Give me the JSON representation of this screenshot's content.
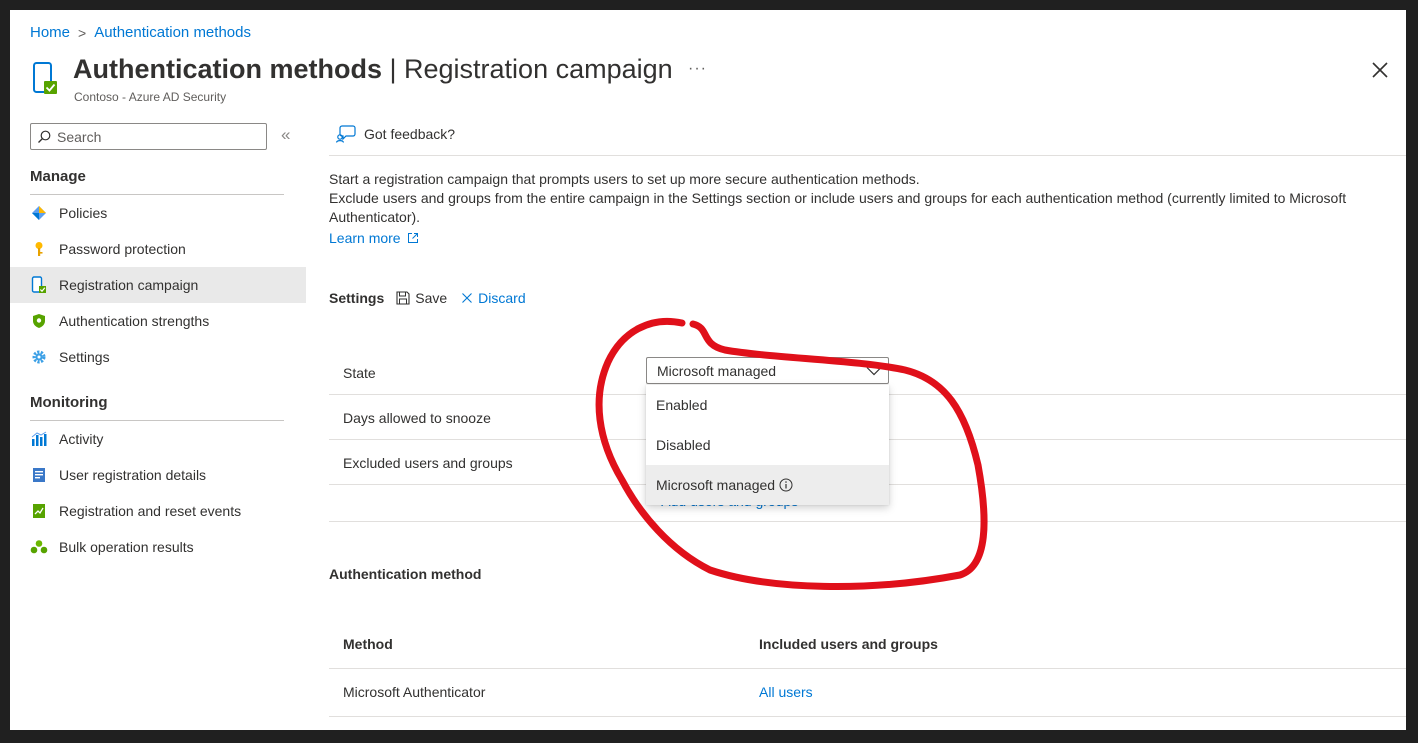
{
  "breadcrumb": {
    "home": "Home",
    "separator": ">",
    "current": "Authentication methods"
  },
  "header": {
    "title_bold": "Authentication methods",
    "title_rest": " | Registration campaign",
    "more": "···",
    "subtitle": "Contoso - Azure AD Security"
  },
  "sidebar": {
    "search_placeholder": "Search",
    "collapse": "«",
    "manage_heading": "Manage",
    "manage_items": [
      {
        "label": "Policies",
        "icon": "policies-icon"
      },
      {
        "label": "Password protection",
        "icon": "key-icon"
      },
      {
        "label": "Registration campaign",
        "icon": "registration-icon",
        "active": true
      },
      {
        "label": "Authentication strengths",
        "icon": "shield-icon"
      },
      {
        "label": "Settings",
        "icon": "gear-icon"
      }
    ],
    "monitoring_heading": "Monitoring",
    "monitoring_items": [
      {
        "label": "Activity",
        "icon": "activity-icon"
      },
      {
        "label": "User registration details",
        "icon": "user-details-icon"
      },
      {
        "label": "Registration and reset events",
        "icon": "events-icon"
      },
      {
        "label": "Bulk operation results",
        "icon": "bulk-icon"
      }
    ]
  },
  "main": {
    "feedback": "Got feedback?",
    "description": [
      "Start a registration campaign that prompts users to set up more secure authentication methods.",
      "Exclude users and groups from the entire campaign in the Settings section or include users and groups for each authentication method (currently limited to Microsoft Authenticator)."
    ],
    "learn_more": "Learn more",
    "settings": {
      "label": "Settings",
      "save": "Save",
      "discard": "Discard"
    },
    "fields": {
      "state": "State",
      "snooze": "Days allowed to snooze",
      "excluded": "Excluded users and groups"
    },
    "state_select": {
      "value": "Microsoft managed",
      "options": [
        "Enabled",
        "Disabled",
        "Microsoft managed"
      ],
      "selected_option": "Microsoft managed"
    },
    "add_users": "+ Add users and groups",
    "auth_method": {
      "title": "Authentication method",
      "headers": {
        "method": "Method",
        "included": "Included users and groups"
      },
      "rows": [
        {
          "method": "Microsoft Authenticator",
          "included": "All users"
        }
      ]
    }
  },
  "colors": {
    "link": "#0078d4",
    "annotation": "#e0101a"
  }
}
